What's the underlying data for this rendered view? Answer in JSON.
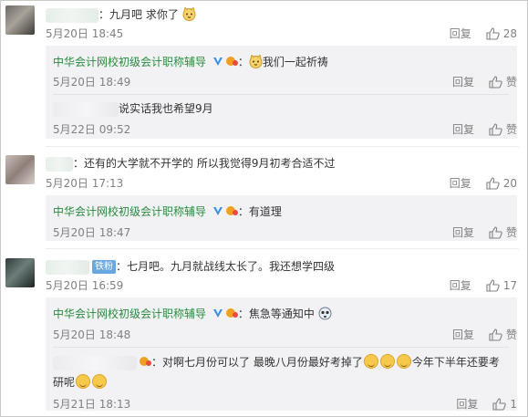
{
  "thread": [
    {
      "type": "comment",
      "text": "：九月吧 求你了",
      "date": "5月20日 18:45",
      "reply": "回复",
      "likes": "28",
      "replies": [
        {
          "author": "中华会计网校初级会计职称辅导",
          "text": "我们一起祈祷",
          "date": "5月20日 18:49",
          "reply": "回复",
          "likes": "赞"
        },
        {
          "author": "",
          "text": "说实话我也希望9月",
          "date": "5月22日 09:52",
          "reply": "回复",
          "likes": "赞"
        }
      ]
    },
    {
      "type": "comment",
      "text": "：还有的大学就不开学的  所以我觉得9月初考合适不过",
      "date": "5月20日 17:13",
      "reply": "回复",
      "likes": "20",
      "replies": [
        {
          "author": "中华会计网校初级会计职称辅导",
          "text": "：有道理",
          "date": "5月20日 18:47",
          "reply": "回复",
          "likes": "赞"
        }
      ]
    },
    {
      "type": "comment",
      "badge": "铁粉",
      "text": "：七月吧。九月就战线太长了。我还想学四级",
      "date": "5月20日 16:59",
      "reply": "回复",
      "likes": "17",
      "replies": [
        {
          "author": "中华会计网校初级会计职称辅导",
          "text": "：焦急等通知中",
          "date": "5月20日 18:48",
          "reply": "回复",
          "likes": "赞"
        },
        {
          "author": "",
          "text": "：对啊七月份可以了 最晚八月份最好考掉了",
          "text2": "今年下半年还要考",
          "text3": "研呢",
          "date": "5月21日 18:13",
          "reply": "回复",
          "likes": "1"
        }
      ]
    }
  ],
  "colors": {
    "link": "#2a8a3e",
    "meta": "#808080",
    "subbg": "#f2f2f5"
  }
}
